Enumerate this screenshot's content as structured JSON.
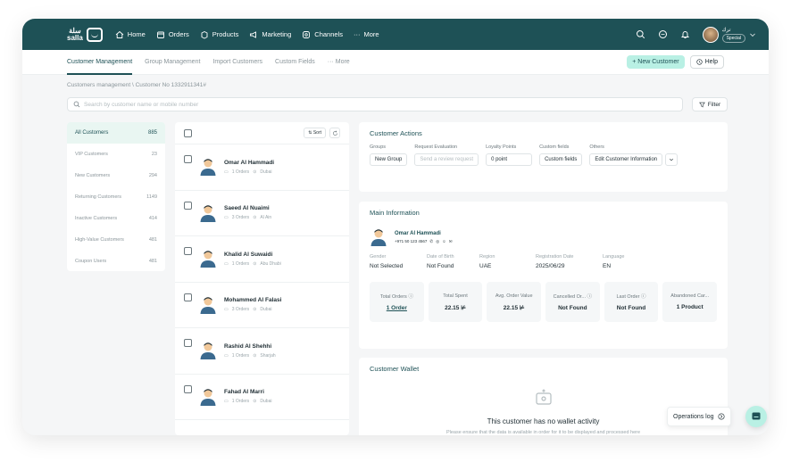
{
  "brand": {
    "logo_text_ar": "سلة",
    "logo_text_en": "salla"
  },
  "nav": [
    {
      "label": "Home",
      "icon": "home-icon"
    },
    {
      "label": "Orders",
      "icon": "orders-icon"
    },
    {
      "label": "Products",
      "icon": "products-icon"
    },
    {
      "label": "Marketing",
      "icon": "marketing-icon"
    },
    {
      "label": "Channels",
      "icon": "channels-icon"
    },
    {
      "label": "More",
      "icon": "more-icon"
    }
  ],
  "user": {
    "name": "ترك",
    "badge": "Special"
  },
  "subnav": {
    "tabs": [
      "Customer Management",
      "Group Management",
      "Import Customers",
      "Custom Fields",
      "More"
    ],
    "new_customer": "+ New Customer",
    "help": "Help"
  },
  "breadcrumb": "Customers management \\ Customer No 1332911341#",
  "search": {
    "placeholder": "Search by customer name or mobile number",
    "filter": "Filter"
  },
  "segments": [
    {
      "label": "All Customers",
      "count": "885"
    },
    {
      "label": "VIP Customers",
      "count": "23"
    },
    {
      "label": "New Customers",
      "count": "294"
    },
    {
      "label": "Returning Customers",
      "count": "1149"
    },
    {
      "label": "Inactive Customers",
      "count": "414"
    },
    {
      "label": "High-Value Customers",
      "count": "481"
    },
    {
      "label": "Coupon Users",
      "count": "481"
    }
  ],
  "list": {
    "sort": "Sort",
    "customers": [
      {
        "name": "Omar Al Hammadi",
        "orders": "1 Orders",
        "city": "Dubai"
      },
      {
        "name": "Saeed Al Nuaimi",
        "orders": "3 Orders",
        "city": "Al Ain"
      },
      {
        "name": "Khalid Al Suwaidi",
        "orders": "1 Orders",
        "city": "Abu Dhabi"
      },
      {
        "name": "Mohammed Al Falasi",
        "orders": "3 Orders",
        "city": "Dubai"
      },
      {
        "name": "Rashid Al Shehhi",
        "orders": "1 Orders",
        "city": "Sharjah"
      },
      {
        "name": "Fahad Al Marri",
        "orders": "1 Orders",
        "city": "Dubai"
      }
    ]
  },
  "actions": {
    "title": "Customer Actions",
    "groups_label": "Groups",
    "groups_value": "New Group",
    "review_label": "Request Evaluation",
    "review_value": "Send a review request",
    "points_label": "Loyalty Points",
    "points_value": "0 point",
    "custom_label": "Custom fields",
    "custom_value": "Custom fields",
    "others_label": "Others",
    "others_value": "Edit Customer Information"
  },
  "main_info": {
    "title": "Main Information",
    "name": "Omar Al Hammadi",
    "phone": "+971 50 123 4567",
    "fields": [
      {
        "label": "Gender",
        "value": "Not Selected"
      },
      {
        "label": "Date of Birth",
        "value": "Not Found"
      },
      {
        "label": "Region",
        "value": "UAE"
      },
      {
        "label": "Registration Date",
        "value": "2025/06/29"
      },
      {
        "label": "Language",
        "value": "EN"
      }
    ],
    "stats": [
      {
        "label": "Total Orders",
        "value": "1 Order"
      },
      {
        "label": "Total Spent",
        "value": "22.15"
      },
      {
        "label": "Avg. Order Value",
        "value": "22.15"
      },
      {
        "label": "Cancelled Or...",
        "value": "Not Found"
      },
      {
        "label": "Last Order",
        "value": "Not Found"
      },
      {
        "label": "Abandoned Car...",
        "value": "1 Product"
      }
    ]
  },
  "wallet": {
    "title": "Customer Wallet",
    "empty_title": "This customer has no wallet activity",
    "empty_sub": "Please ensure that the data is available in order for it to be displayed and processed here"
  },
  "operations_log": "Operations log",
  "colors": {
    "primary": "#1e5156",
    "accent": "#b9f0e4",
    "background": "#f5f6f7"
  }
}
